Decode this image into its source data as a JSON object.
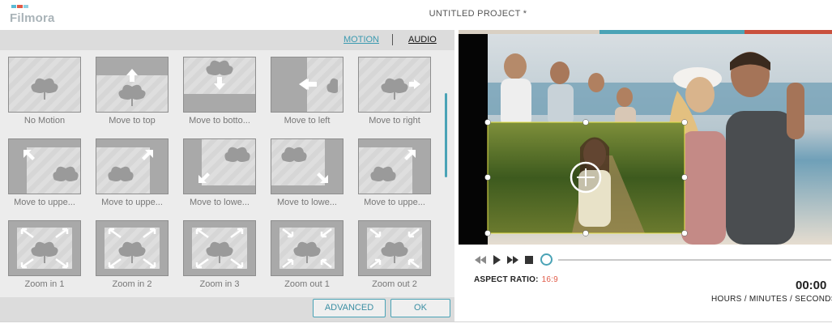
{
  "app": {
    "logo_text": "Filmora",
    "project_title": "UNTITLED PROJECT *"
  },
  "tabs": [
    {
      "label": "MOTION",
      "active": true
    },
    {
      "label": "AUDIO",
      "active": false
    }
  ],
  "motions": [
    {
      "label": "No Motion",
      "icon": "leaf-icon"
    },
    {
      "label": "Move to top",
      "icon": "arrow-up-icon"
    },
    {
      "label": "Move to botto...",
      "icon": "arrow-down-icon"
    },
    {
      "label": "Move to left",
      "icon": "arrow-left-icon"
    },
    {
      "label": "Move to right",
      "icon": "arrow-right-icon"
    },
    {
      "label": "Move to uppe...",
      "icon": "arrow-up-left-icon"
    },
    {
      "label": "Move to uppe...",
      "icon": "arrow-up-right-icon"
    },
    {
      "label": "Move to lowe...",
      "icon": "arrow-down-left-icon"
    },
    {
      "label": "Move to lowe...",
      "icon": "arrow-down-right-icon"
    },
    {
      "label": "Move to uppe...",
      "icon": "arrow-up-right-icon"
    },
    {
      "label": "Zoom in 1",
      "icon": "zoom-in-icon"
    },
    {
      "label": "Zoom in 2",
      "icon": "zoom-in-icon"
    },
    {
      "label": "Zoom in 3",
      "icon": "zoom-in-icon"
    },
    {
      "label": "Zoom out 1",
      "icon": "zoom-out-icon"
    },
    {
      "label": "Zoom out 2",
      "icon": "zoom-out-icon"
    }
  ],
  "buttons": {
    "advanced": "ADVANCED",
    "ok": "OK"
  },
  "player": {
    "controls": [
      "rewind-icon",
      "play-icon",
      "fast-forward-icon",
      "stop-icon"
    ],
    "progress": 0
  },
  "aspect": {
    "label": "ASPECT RATIO:",
    "value": "16:9"
  },
  "time": {
    "value": "00:00",
    "units": "HOURS / MINUTES / SECONDS"
  },
  "colors": {
    "accent": "#4aa3b6",
    "brand_red": "#e05a47",
    "strip": [
      "#d9d0c3",
      "#4aa3b6",
      "#c9503d"
    ]
  }
}
